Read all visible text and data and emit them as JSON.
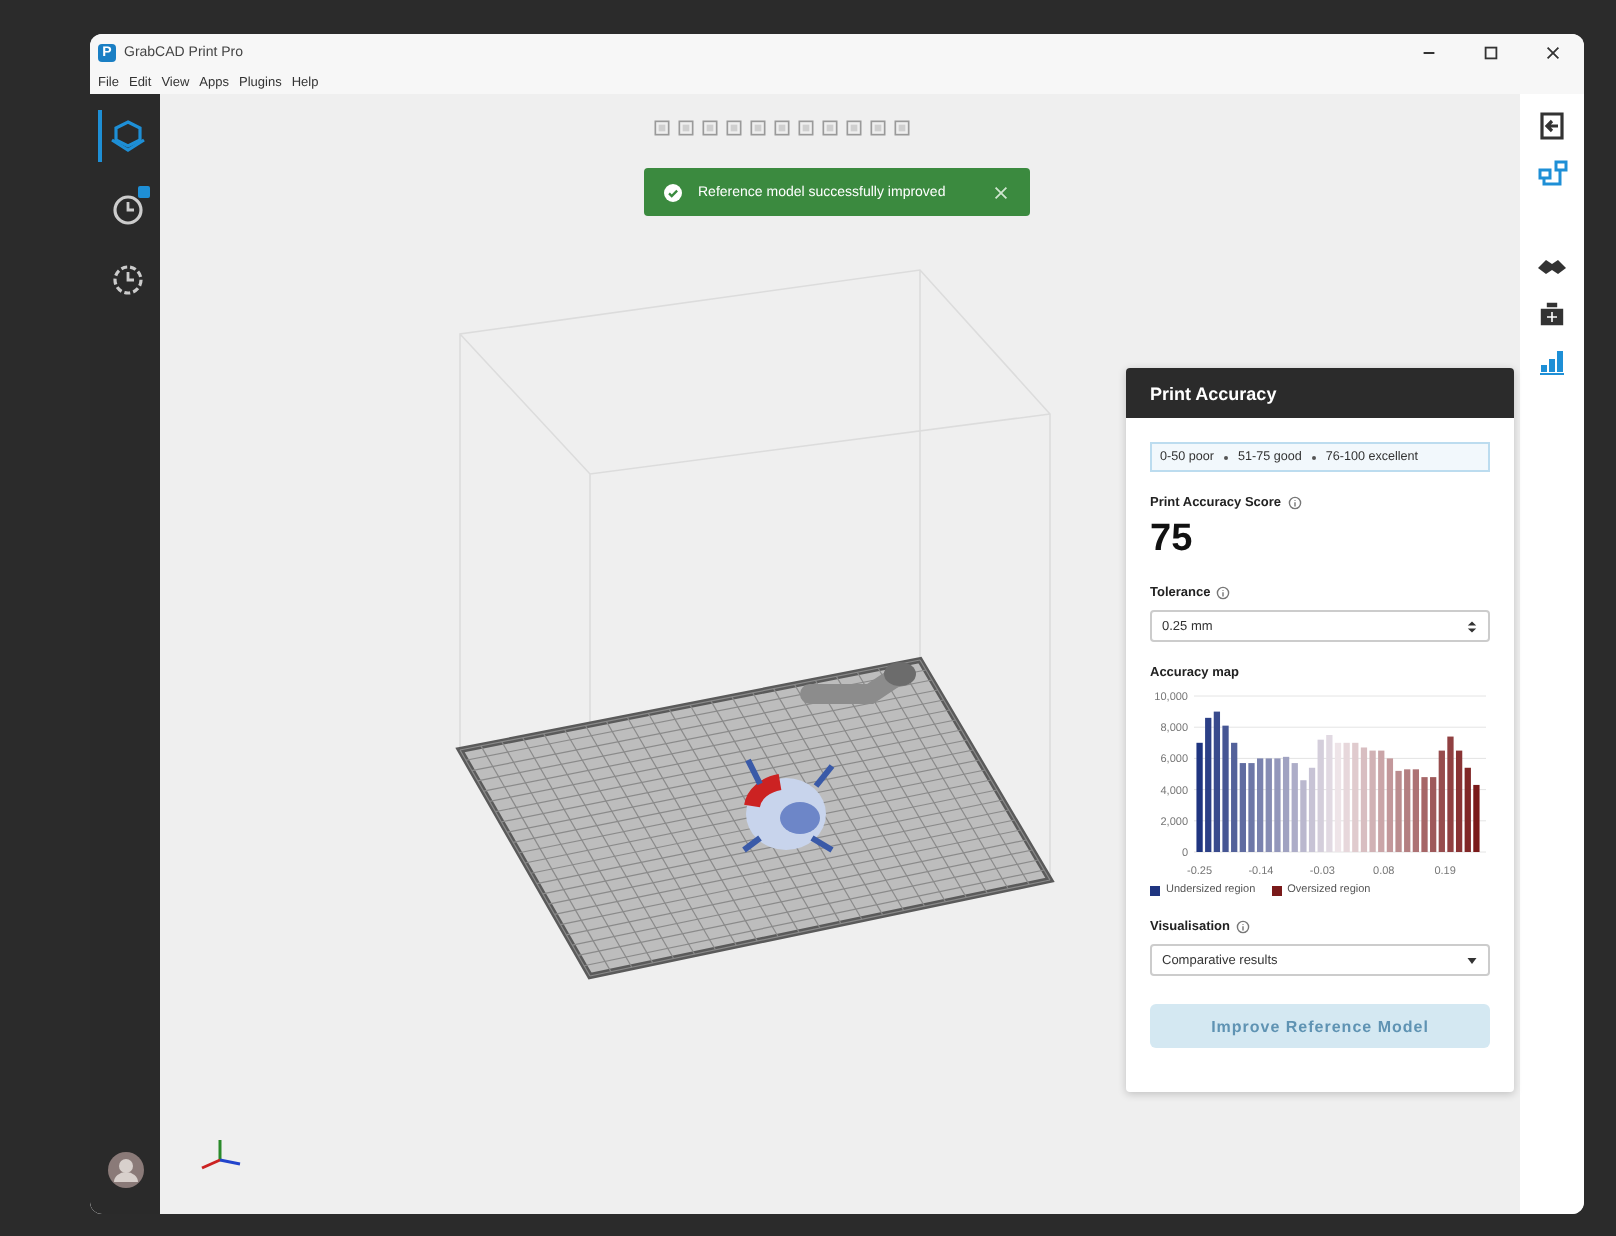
{
  "window": {
    "logo": "P",
    "title": "GrabCAD Print Pro"
  },
  "menu": [
    "File",
    "Edit",
    "View",
    "Apps",
    "Plugins",
    "Help"
  ],
  "left_sidebar": {
    "items": [
      {
        "kind": "models",
        "selected": true
      },
      {
        "kind": "queue",
        "selected": false,
        "badge": true
      },
      {
        "kind": "history",
        "selected": false
      }
    ]
  },
  "toast": {
    "text": "Reference model successfully improved"
  },
  "right_sidebar": {
    "items": [
      {
        "kind": "exit",
        "active": false
      },
      {
        "kind": "layout",
        "active": true
      },
      {
        "kind": "models",
        "active": false
      },
      {
        "kind": "printer",
        "active": false
      },
      {
        "kind": "chart",
        "active": true
      }
    ]
  },
  "panel": {
    "title": "Print Accuracy",
    "scale": [
      "0-50 poor",
      "51-75 good",
      "76-100 excellent"
    ],
    "score_label": "Print Accuracy Score",
    "score": "75",
    "tolerance_label": "Tolerance",
    "tolerance_value": "0.25 mm",
    "map_label": "Accuracy map",
    "chart_data": {
      "type": "bar",
      "x": [
        -0.25,
        -0.2345,
        -0.219,
        -0.2035,
        -0.188,
        -0.1725,
        -0.157,
        -0.1415,
        -0.126,
        -0.1105,
        -0.095,
        -0.0795,
        -0.064,
        -0.0485,
        -0.033,
        -0.0175,
        -0.002,
        0.0135,
        0.029,
        0.0445,
        0.06,
        0.0755,
        0.091,
        0.1065,
        0.122,
        0.1375,
        0.153,
        0.1685,
        0.184,
        0.1995,
        0.215,
        0.2305,
        0.246
      ],
      "grid": true,
      "series": [
        {
          "values": [
            7000,
            8600,
            9000,
            8100,
            7000,
            5700,
            5700,
            6000,
            6000,
            6000,
            6100,
            5700,
            4600,
            5400,
            7200,
            7500,
            7000,
            7000,
            7000,
            6700,
            6500,
            6500,
            6000,
            5200,
            5300,
            5300,
            4800,
            4800,
            6500,
            7400,
            6500,
            5400,
            4300
          ]
        }
      ],
      "xlim": [
        -0.26,
        0.256
      ],
      "ylim": [
        0,
        10000
      ],
      "xticks": [
        -0.25,
        -0.14,
        -0.03,
        0.08,
        0.19
      ],
      "yticks": [
        {
          "value": 0,
          "label": "0"
        },
        {
          "value": 2000,
          "label": "2,000"
        },
        {
          "value": 4000,
          "label": "4,000"
        },
        {
          "value": 6000,
          "label": "6,000"
        },
        {
          "value": 8000,
          "label": "8,000"
        },
        {
          "value": 10000,
          "label": "10,000"
        }
      ]
    },
    "legend": [
      {
        "label": "Undersized region",
        "color": "#1f3580"
      },
      {
        "label": "Oversized region",
        "color": "#7a1a1a"
      }
    ],
    "visualisation_label": "Visualisation",
    "visualisation_value": "Comparative results",
    "button": {
      "label": "Improve Reference Model",
      "disabled": true
    }
  }
}
